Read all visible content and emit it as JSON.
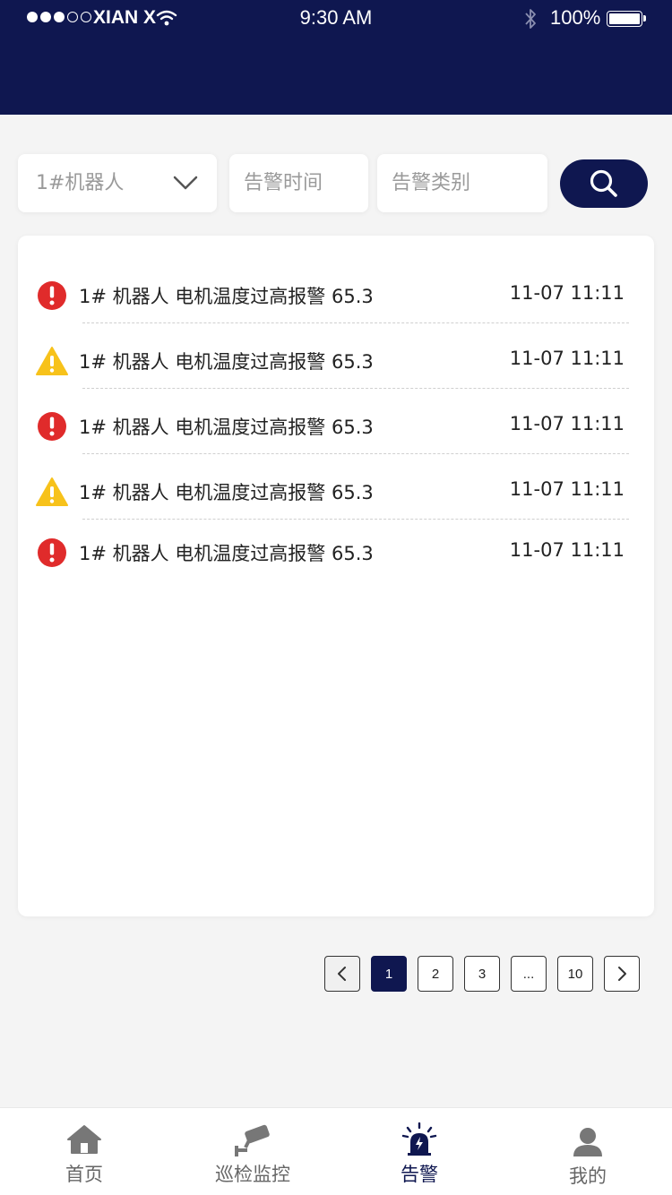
{
  "status_bar": {
    "carrier": "XIAN X",
    "time": "9:30 AM",
    "battery": "100%"
  },
  "filters": {
    "robot": "1#机器人",
    "time_placeholder": "告警时间",
    "type_placeholder": "告警类别"
  },
  "alarms": [
    {
      "level": "error",
      "text": "1# 机器人 电机温度过高报警 65.3",
      "time": "11-07 11:11"
    },
    {
      "level": "warning",
      "text": "1# 机器人 电机温度过高报警 65.3",
      "time": "11-07 11:11"
    },
    {
      "level": "error",
      "text": "1# 机器人 电机温度过高报警 65.3",
      "time": "11-07 11:11"
    },
    {
      "level": "warning",
      "text": "1# 机器人 电机温度过高报警 65.3",
      "time": "11-07 11:11"
    },
    {
      "level": "error",
      "text": "1# 机器人 电机温度过高报警 65.3",
      "time": "11-07 11:11"
    }
  ],
  "pagination": {
    "pages": [
      "1",
      "2",
      "3",
      "...",
      "10"
    ],
    "current": "1"
  },
  "tabs": [
    {
      "label": "首页",
      "icon": "home-icon"
    },
    {
      "label": "巡检监控",
      "icon": "camera-icon"
    },
    {
      "label": "告警",
      "icon": "alarm-light-icon",
      "active": true
    },
    {
      "label": "我的",
      "icon": "user-icon"
    }
  ],
  "colors": {
    "primary": "#0f1750",
    "error": "#e02b2b",
    "warning": "#f7c21b",
    "background": "#f4f4f4"
  }
}
